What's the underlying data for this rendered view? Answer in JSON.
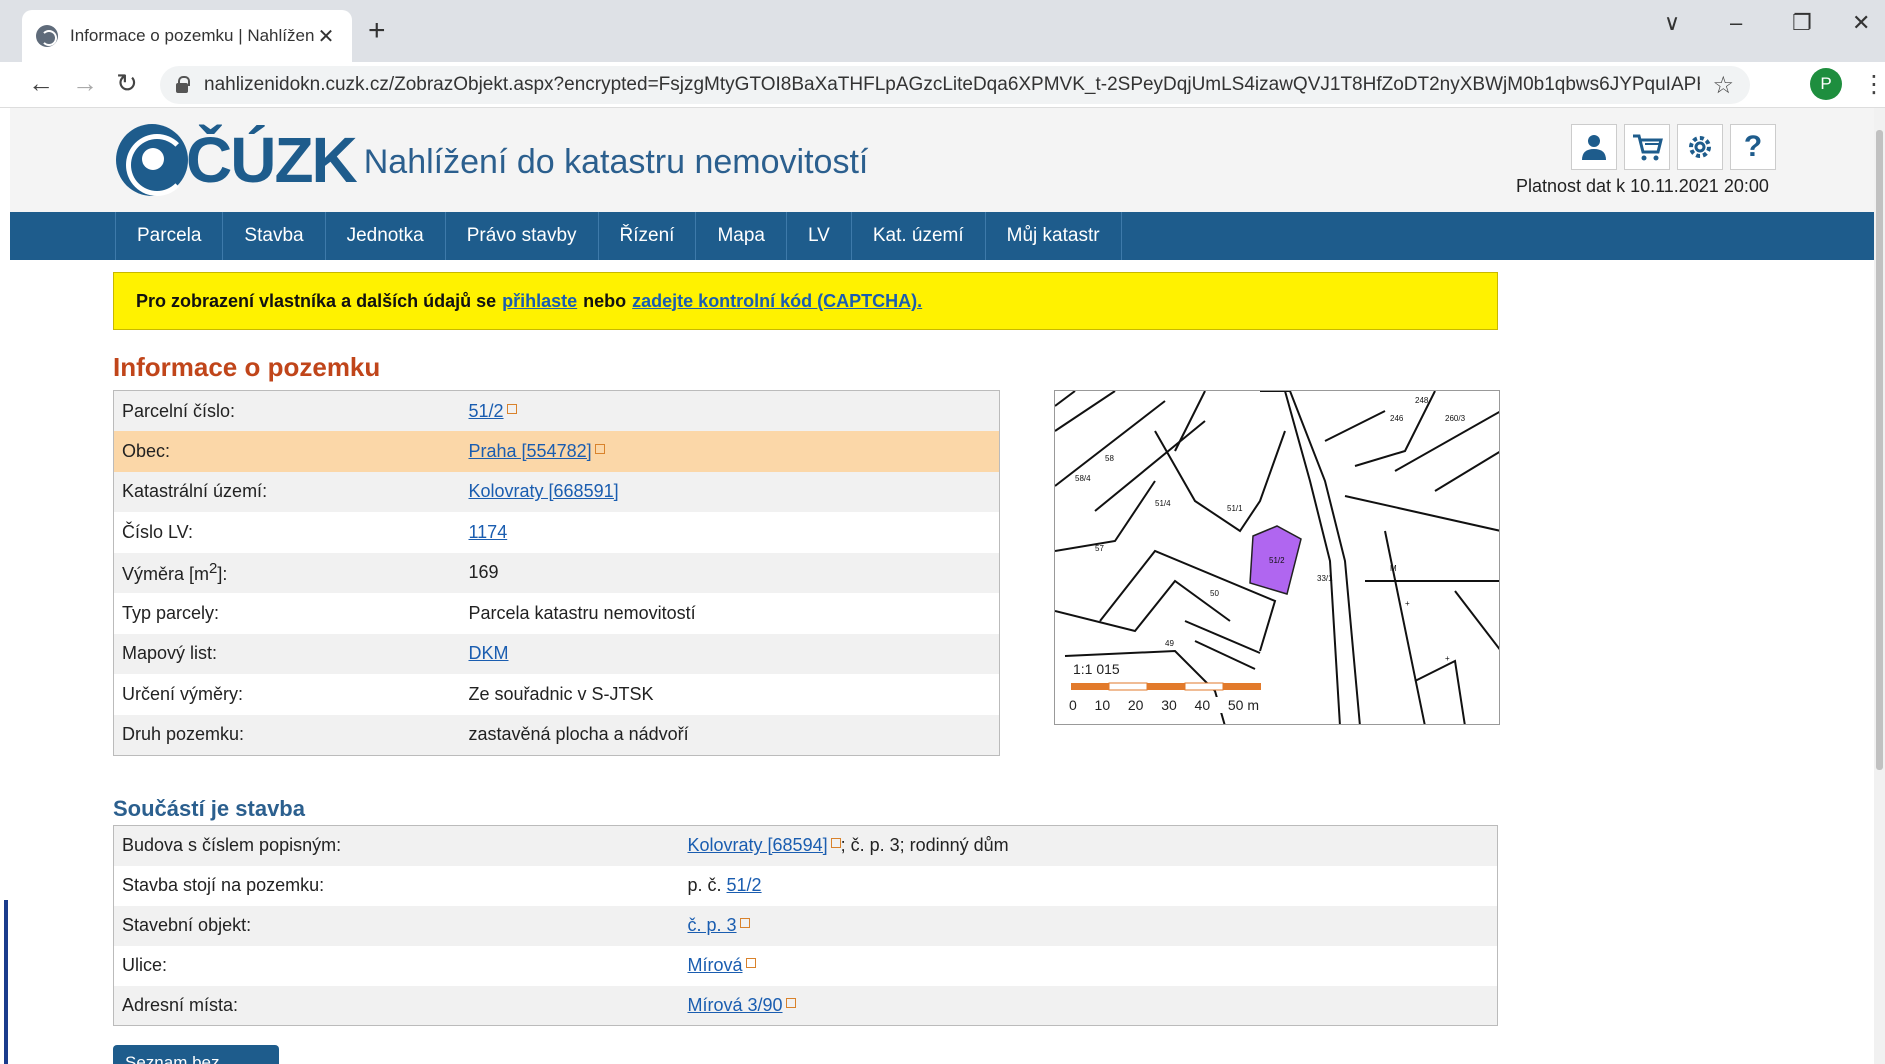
{
  "browser": {
    "tab_title": "Informace o pozemku | Nahlížení",
    "tab_close": "✕",
    "new_tab": "+",
    "url": "nahlizenidokn.cuzk.cz/ZobrazObjekt.aspx?encrypted=FsjzgMtyGTOI8BaXaTHFLpAGzcLiteDqa6XPMVK_t-2SPeyDqjUmLS4izawQVJ1T8HfZoDT2nyXBWjM0b1qbws6JYPquIAPH-VUPy...",
    "profile_initial": "P",
    "back": "←",
    "forward": "→",
    "reload": "↻",
    "star": "☆",
    "menu": "⋮",
    "tab_list": "∨",
    "minimize": "–",
    "restore": "❐",
    "close": "✕"
  },
  "header": {
    "brand": "ČÚZK",
    "app_title": "Nahlížení do katastru nemovitostí",
    "validity": "Platnost dat k 10.11.2021 20:00",
    "icons": [
      "user-icon",
      "cart-icon",
      "settings-icon",
      "help-icon"
    ]
  },
  "nav": [
    "Parcela",
    "Stavba",
    "Jednotka",
    "Právo stavby",
    "Řízení",
    "Mapa",
    "LV",
    "Kat. území",
    "Můj katastr"
  ],
  "notice": {
    "before": "Pro zobrazení vlastníka a dalších údajů se",
    "login_link": "přihlaste",
    "middle": "nebo",
    "captcha_link": "zadejte kontrolní kód (CAPTCHA)."
  },
  "page_title": "Informace o pozemku",
  "parcel": {
    "number_label": "Parcelní číslo:",
    "number": "51/2",
    "obec_label": "Obec:",
    "obec": "Praha [554782]",
    "ku_label": "Katastrální území:",
    "ku": "Kolovraty [668591]",
    "lv_label": "Číslo LV:",
    "lv": "1174",
    "area_label_pre": "Výměra [m",
    "area_label_sup": "2",
    "area_label_post": "]:",
    "area": "169",
    "type_label": "Typ parcely:",
    "type": "Parcela katastru nemovitostí",
    "sheet_label": "Mapový list:",
    "sheet": "DKM",
    "determination_label": "Určení výměry:",
    "determination": "Ze souřadnic v S-JTSK",
    "kind_label": "Druh pozemku:",
    "kind": "zastavěná plocha a nádvoří"
  },
  "map": {
    "scale": "1:1 015",
    "scale_ticks": [
      "0",
      "10",
      "20",
      "30",
      "40",
      "50 m"
    ],
    "highlight_color": "#b066f0"
  },
  "building_title": "Součástí je stavba",
  "building": {
    "building_label": "Budova s číslem popisným:",
    "building_link": "Kolovraty [68594]",
    "building_rest": "; č. p. 3; rodinný dům",
    "stands_label": "Stavba stojí na pozemku:",
    "stands_prefix": "p. č.",
    "stands_link": "51/2",
    "object_label": "Stavební objekt:",
    "object_link": "č. p. 3",
    "street_label": "Ulice:",
    "street_link": "Mírová",
    "address_label": "Adresní místa:",
    "address_link": "Mírová 3/90"
  },
  "bottom_button": "Seznam bez"
}
